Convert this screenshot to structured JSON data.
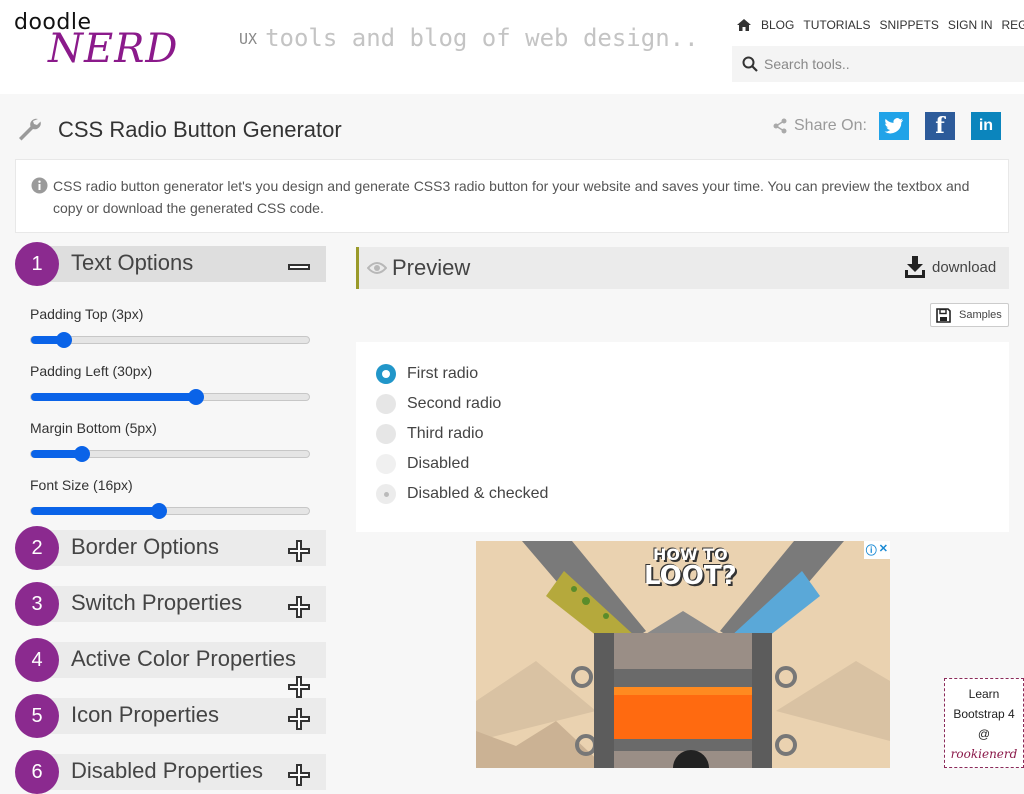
{
  "header": {
    "logo_top": "doodle",
    "logo_bottom": "NERD",
    "tagline_prefix": "UX",
    "tagline": "tools and blog of web design..",
    "nav": [
      "BLOG",
      "TUTORIALS",
      "SNIPPETS",
      "SIGN IN",
      "REGISTER"
    ],
    "search_placeholder": "Search tools.."
  },
  "page": {
    "title": "CSS Radio Button Generator",
    "share_label": "Share On:",
    "info": "CSS radio button generator let's you design and generate CSS3 radio button for your website and saves your time. You can preview the textbox and copy or download the generated CSS code."
  },
  "sections": [
    {
      "num": "1",
      "label": "Text Options",
      "open": true
    },
    {
      "num": "2",
      "label": "Border Options",
      "open": false
    },
    {
      "num": "3",
      "label": "Switch Properties",
      "open": false
    },
    {
      "num": "4",
      "label": "Active Color Properties",
      "open": false
    },
    {
      "num": "5",
      "label": "Icon Properties",
      "open": false
    },
    {
      "num": "6",
      "label": "Disabled Properties",
      "open": false
    }
  ],
  "sliders": [
    {
      "label": "Padding Top (3px)",
      "fraction": 0.12
    },
    {
      "label": "Padding Left (30px)",
      "fraction": 0.595
    },
    {
      "label": "Margin Bottom (5px)",
      "fraction": 0.185
    },
    {
      "label": "Font Size (16px)",
      "fraction": 0.46
    }
  ],
  "preview": {
    "title": "Preview",
    "download_label": "download",
    "samples_label": "Samples",
    "radios": [
      {
        "label": "First radio",
        "state": "checked"
      },
      {
        "label": "Second radio",
        "state": "normal"
      },
      {
        "label": "Third radio",
        "state": "normal"
      },
      {
        "label": "Disabled",
        "state": "disabled"
      },
      {
        "label": "Disabled & checked",
        "state": "dischecked"
      }
    ]
  },
  "ad": {
    "title_line1": "HOW TO",
    "title_line2": "LOOT?"
  },
  "badge": {
    "line1": "Learn",
    "line2": "Bootstrap 4",
    "line3": "@",
    "line4": "rookienerd"
  },
  "colors": {
    "accent_purple": "#8b2a8f",
    "slider_blue": "#0a63e8",
    "radio_checked": "#2196c9",
    "preview_border": "#9a9a2a"
  }
}
